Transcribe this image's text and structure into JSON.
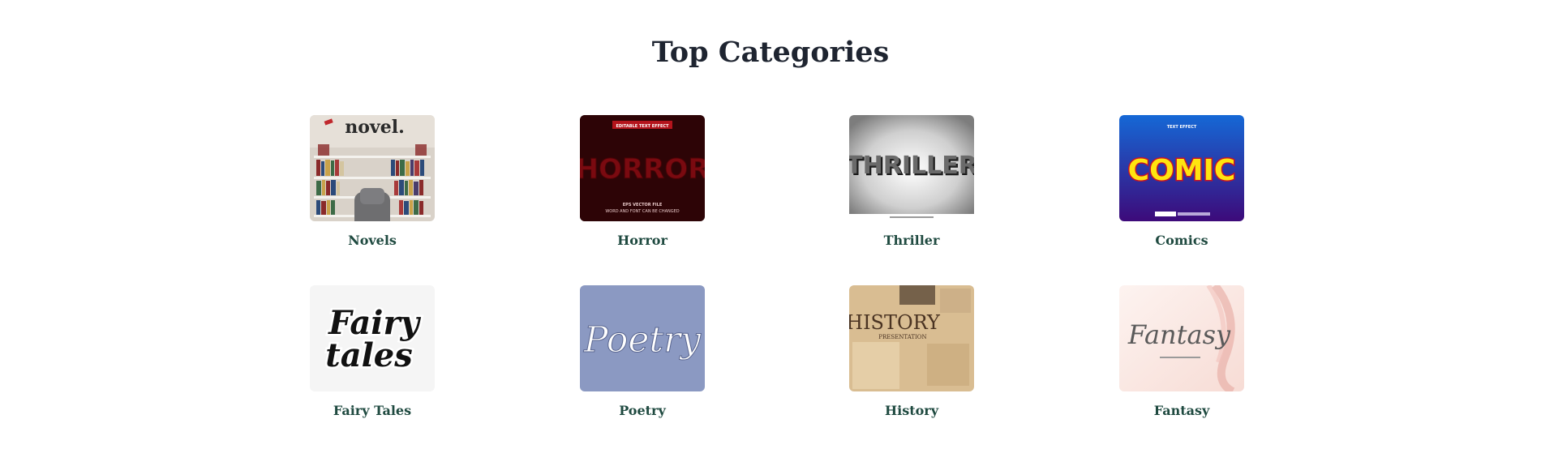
{
  "section": {
    "title": "Top Categories"
  },
  "categories": [
    {
      "label": "Novels",
      "image_text": "novel."
    },
    {
      "label": "Horror",
      "image_text": "HORROR",
      "image_banner": "EDITABLE TEXT EFFECT",
      "image_caption": "EPS VECTOR FILE",
      "image_subcaption": "WORD AND FONT CAN BE CHANGED"
    },
    {
      "label": "Thriller",
      "image_text": "THRILLER"
    },
    {
      "label": "Comics",
      "image_text": "COMIC",
      "image_banner": "TEXT EFFECT"
    },
    {
      "label": "Fairy Tales",
      "image_text": "Fairy",
      "image_text2": "tales"
    },
    {
      "label": "Poetry",
      "image_text": "Poetry"
    },
    {
      "label": "History",
      "image_text": "HISTORY",
      "image_caption": "PRESENTATION"
    },
    {
      "label": "Fantasy",
      "image_text": "Fantasy"
    }
  ]
}
